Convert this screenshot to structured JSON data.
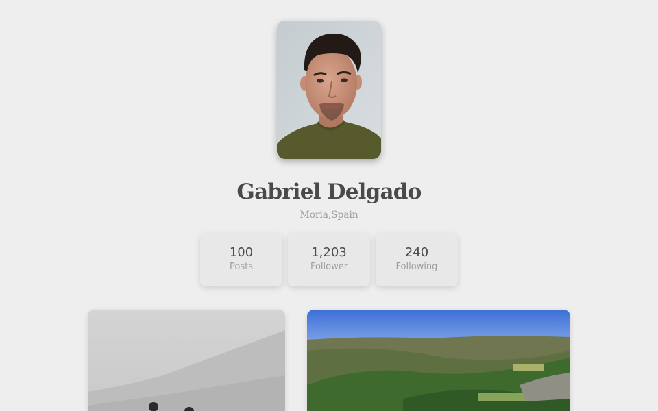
{
  "profile": {
    "name": "Gabriel Delgado",
    "location": "Moria,Spain",
    "avatar": "profile-photo-man-green-shirt"
  },
  "stats": [
    {
      "value": "100",
      "label": "Posts"
    },
    {
      "value": "1,203",
      "label": "Follower"
    },
    {
      "value": "240",
      "label": "Following"
    }
  ],
  "gallery": [
    {
      "image": "misty-hillside-grayscale-two-people"
    },
    {
      "image": "green-valley-blue-sky"
    }
  ],
  "colors": {
    "background": "#eeeeee",
    "name_text": "#4a4a4a",
    "muted_text": "#9b9b9b",
    "card_background": "#e8e8e8"
  }
}
